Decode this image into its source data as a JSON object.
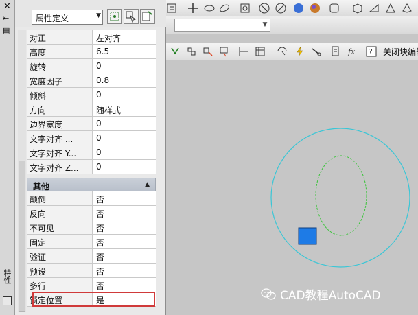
{
  "palette_strip": {
    "close_glyph": "✕",
    "title": "特性"
  },
  "props_header": {
    "type_select_value": "属性定义",
    "buttons": [
      "quick-select-icon",
      "select-objects-icon",
      "toggle-pickadd-icon"
    ]
  },
  "properties": [
    {
      "label": "对正",
      "value": "左对齐"
    },
    {
      "label": "高度",
      "value": "6.5"
    },
    {
      "label": "旋转",
      "value": "0"
    },
    {
      "label": "宽度因子",
      "value": "0.8"
    },
    {
      "label": "倾斜",
      "value": "0"
    },
    {
      "label": "方向",
      "value": "随样式"
    },
    {
      "label": "边界宽度",
      "value": "0"
    },
    {
      "label": "文字对齐 ...",
      "value": "0"
    },
    {
      "label": "文字对齐 Y...",
      "value": "0"
    },
    {
      "label": "文字对齐 Z...",
      "value": "0"
    }
  ],
  "section_other": {
    "label": "其他",
    "toggle": "▲",
    "items": [
      {
        "label": "颠倒",
        "value": "否"
      },
      {
        "label": "反向",
        "value": "否"
      },
      {
        "label": "不可见",
        "value": "否"
      },
      {
        "label": "固定",
        "value": "否"
      },
      {
        "label": "验证",
        "value": "否"
      },
      {
        "label": "预设",
        "value": "否"
      },
      {
        "label": "多行",
        "value": "否"
      },
      {
        "label": "锁定位置",
        "value": "是"
      }
    ]
  },
  "toolbar": {
    "close_block_editor": "关闭块编辑"
  },
  "watermark": {
    "text": "CAD教程AutoCAD"
  },
  "colors": {
    "circle_outline": "#39c6d6",
    "ellipse_dashed": "#3bc43b",
    "grip": "#1e7be6",
    "highlight": "#d03a3a"
  }
}
